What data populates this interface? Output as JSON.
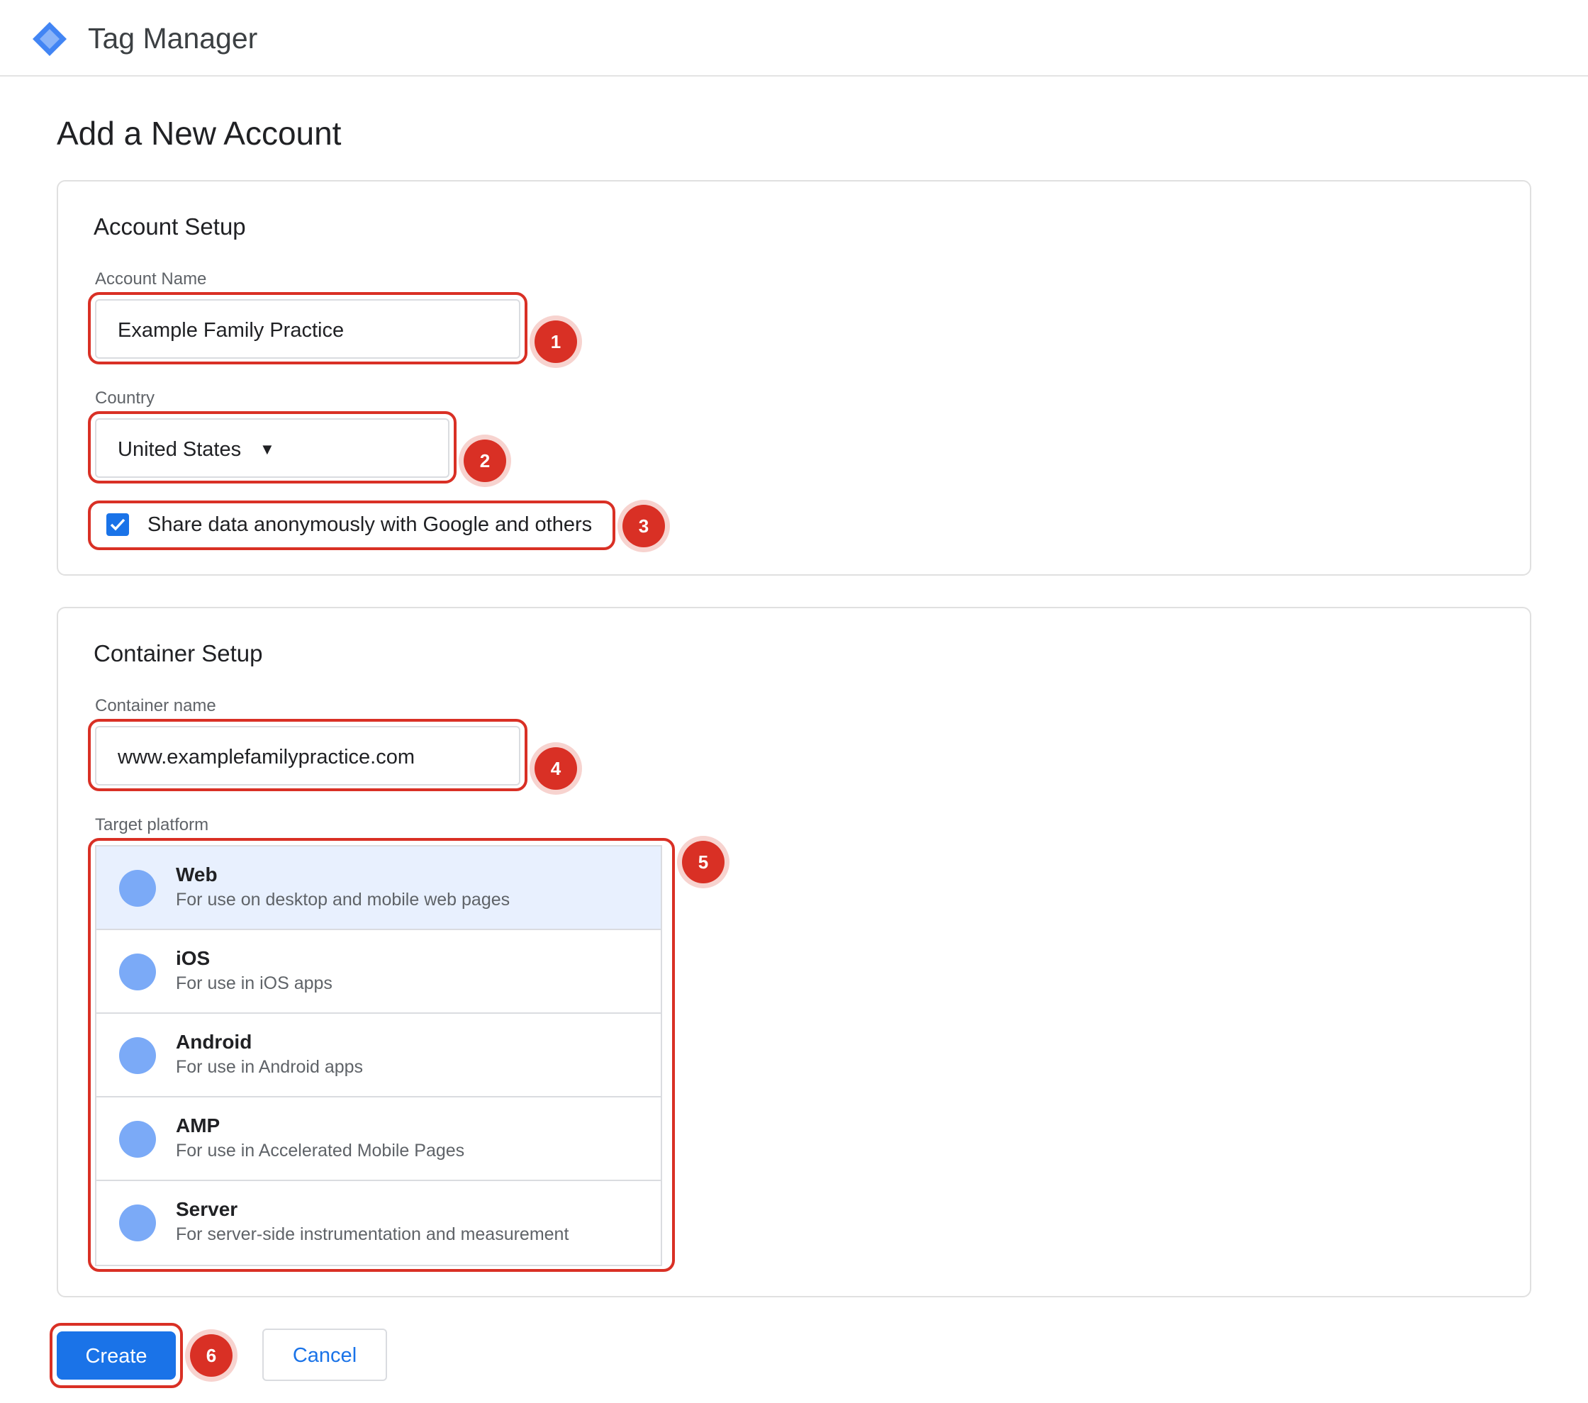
{
  "header": {
    "app_title": "Tag Manager",
    "logo_icon": "tag-manager-diamond-icon",
    "brand_color": "#4285f4"
  },
  "page": {
    "title": "Add a New Account"
  },
  "account_setup": {
    "title": "Account Setup",
    "account_name_label": "Account Name",
    "account_name_value": "Example Family Practice",
    "country_label": "Country",
    "country_value": "United States",
    "country_arrow": "▼",
    "share_data_label": "Share data anonymously with Google and others",
    "share_data_checked": true
  },
  "container_setup": {
    "title": "Container Setup",
    "container_name_label": "Container name",
    "container_name_value": "www.examplefamilypractice.com",
    "target_platform_label": "Target platform",
    "platforms": [
      {
        "name": "Web",
        "description": "For use on desktop and mobile web pages",
        "selected": true
      },
      {
        "name": "iOS",
        "description": "For use in iOS apps",
        "selected": false
      },
      {
        "name": "Android",
        "description": "For use in Android apps",
        "selected": false
      },
      {
        "name": "AMP",
        "description": "For use in Accelerated Mobile Pages",
        "selected": false
      },
      {
        "name": "Server",
        "description": "For server-side instrumentation and measurement",
        "selected": false
      }
    ]
  },
  "actions": {
    "create_label": "Create",
    "cancel_label": "Cancel"
  },
  "step_markers": [
    "1",
    "2",
    "3",
    "4",
    "5",
    "6"
  ],
  "colors": {
    "primary": "#1a73e8",
    "highlight": "#d93025",
    "selected_row": "#e8f0fe",
    "platform_icon": "#7baaf7"
  }
}
